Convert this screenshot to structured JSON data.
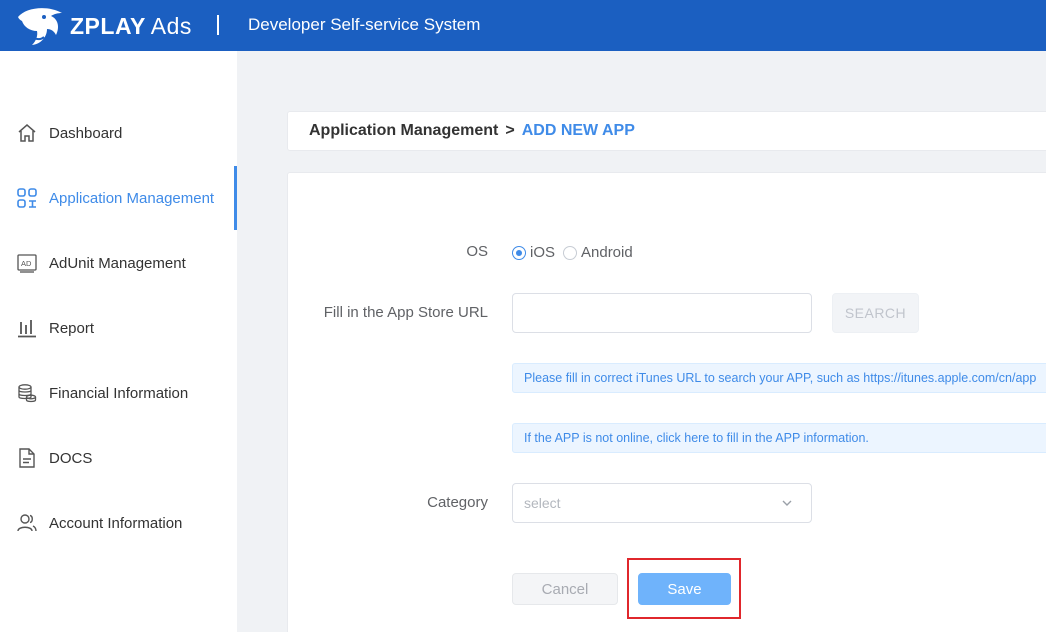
{
  "header": {
    "logo_text": "ZPLAY",
    "logo_suffix": "Ads",
    "title": "Developer Self-service System",
    "colors": {
      "bar": "#1b5fc1",
      "accent": "#3f8be8"
    }
  },
  "sidebar": {
    "items": [
      {
        "label": "Dashboard",
        "icon": "home-icon"
      },
      {
        "label": "Application Management",
        "icon": "apps-grid-icon",
        "active": true
      },
      {
        "label": "AdUnit Management",
        "icon": "ad-icon"
      },
      {
        "label": "Report",
        "icon": "bar-chart-icon"
      },
      {
        "label": "Financial Information",
        "icon": "coins-icon"
      },
      {
        "label": "DOCS",
        "icon": "document-icon"
      },
      {
        "label": "Account Information",
        "icon": "users-icon"
      }
    ]
  },
  "breadcrumb": {
    "parent": "Application Management",
    "separator": ">",
    "current": "ADD NEW APP"
  },
  "form": {
    "os_label": "OS",
    "os_options": [
      {
        "label": "iOS",
        "checked": true
      },
      {
        "label": "Android",
        "checked": false
      }
    ],
    "url_label": "Fill in the App Store URL",
    "url_value": "",
    "url_placeholder": "",
    "search_label": "SEARCH",
    "hint_itunes": "Please fill in correct iTunes URL to search your APP, such as https://itunes.apple.com/cn/app",
    "hint_offline": "If the APP is not online, click here to fill in the APP information.",
    "category_label": "Category",
    "category_placeholder": "select",
    "cancel_label": "Cancel",
    "save_label": "Save"
  }
}
